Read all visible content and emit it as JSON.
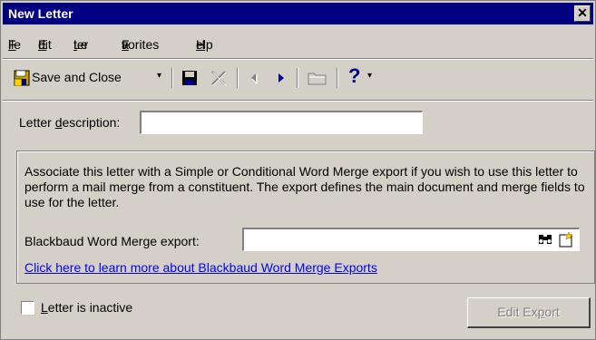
{
  "window": {
    "title": "New Letter"
  },
  "menu": [
    {
      "label": "File",
      "ul": "F",
      "rest": "ile"
    },
    {
      "label": "Edit",
      "ul": "E",
      "rest": "dit"
    },
    {
      "label": "Letter",
      "ul": "",
      "rest": "Le",
      "ul2": "t",
      "rest2": "ter"
    },
    {
      "label": "Favorites",
      "ul": "",
      "rest": "F",
      "ul2": "a",
      "rest2": "vorites"
    },
    {
      "label": "Help",
      "ul": "H",
      "rest": "elp"
    }
  ],
  "toolbar": {
    "save_and_close_label": "Save and Close",
    "icons": [
      "save-disk-icon",
      "delete-x-icon",
      "previous-arrow-icon",
      "next-arrow-icon",
      "folder-icon",
      "help-question-icon"
    ]
  },
  "form": {
    "letter_description_label_pre": "Letter ",
    "letter_description_label_ul": "d",
    "letter_description_label_post": "escription:",
    "letter_description_value": "",
    "group_text": "Associate this letter with a Simple or Conditional Word Merge export if you wish to use this letter to perform a mail merge from a constituent.  The export defines the main document and merge fields to use for the letter.",
    "export_label": "Blackbaud Word Merge export:",
    "export_value": "",
    "learn_more_link": "Click here to learn more about Blackbaud Word Merge Exports",
    "inactive_label_ul": "L",
    "inactive_label_rest": "etter is inactive",
    "inactive_checked": false,
    "edit_export_pre": "Edit Ex",
    "edit_export_ul": "p",
    "edit_export_post": "ort"
  },
  "colors": {
    "titlebar": "#000080",
    "face": "#d4d0c8",
    "link": "#0000ff"
  }
}
